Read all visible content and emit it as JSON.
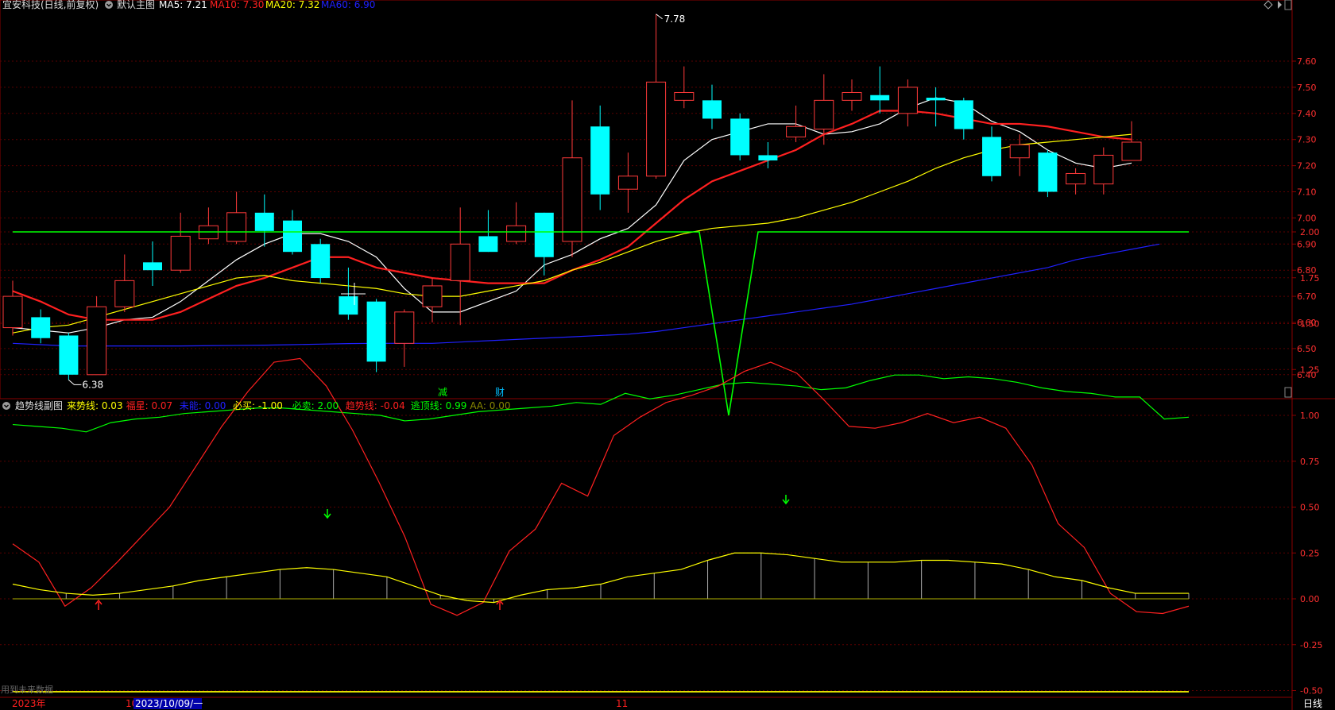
{
  "main_header": {
    "stock_title": "宜安科技(日线,前复权)",
    "chart_name": "默认主图",
    "ma5": {
      "label": "MA5: 7.21",
      "color": "#ffffff"
    },
    "ma10": {
      "label": "MA10: 7.30",
      "color": "#ff2020"
    },
    "ma20": {
      "label": "MA20: 7.32",
      "color": "#ffff00"
    },
    "ma60": {
      "label": "MA60: 6.90",
      "color": "#2020ff"
    }
  },
  "sub_header": {
    "chart_name": "趋势线副图",
    "items": [
      {
        "label": "来势线: 0.03",
        "color": "#ffff00"
      },
      {
        "label": "福星: 0.07",
        "color": "#ff2020"
      },
      {
        "label": "未能: 0.00",
        "color": "#2020ff"
      },
      {
        "label": "必买: -1.00",
        "color": "#ffff00"
      },
      {
        "label": "必卖: 2.00",
        "color": "#00ff00"
      },
      {
        "label": "趋势线: -0.04",
        "color": "#ff2020"
      },
      {
        "label": "逃顶线: 0.99",
        "color": "#00ff00"
      },
      {
        "label": "AA: 0.00",
        "color": "#888800"
      }
    ]
  },
  "price_axis": {
    "ticks": [
      "7.60",
      "7.50",
      "7.40",
      "7.30",
      "7.20",
      "7.10",
      "7.00",
      "6.90",
      "6.80",
      "6.70",
      "6.60",
      "6.50",
      "6.40"
    ]
  },
  "indicator_axis": {
    "ticks": [
      "2.00",
      "1.75",
      "1.50",
      "1.25",
      "1.00",
      "0.75",
      "0.50",
      "0.25",
      "0.00",
      "-0.25",
      "-0.50"
    ]
  },
  "annotations": {
    "high_label": "7.78",
    "low_label": "6.38",
    "event_1": "减",
    "event_2": "财"
  },
  "bottom_bar": {
    "year": "2023年",
    "marker_10": "10",
    "cursor_date": "2023/10/09/一",
    "marker_11": "11",
    "period": "日线",
    "future_note": "用到未来数据"
  },
  "chart_data": [
    {
      "type": "candlestick",
      "title": "宜安科技(日线,前复权)",
      "ylim": [
        6.34,
        7.8
      ],
      "candles": [
        {
          "o": 6.58,
          "h": 6.76,
          "l": 6.55,
          "c": 6.7
        },
        {
          "o": 6.62,
          "h": 6.65,
          "l": 6.52,
          "c": 6.54
        },
        {
          "o": 6.55,
          "h": 6.56,
          "l": 6.38,
          "c": 6.4
        },
        {
          "o": 6.4,
          "h": 6.7,
          "l": 6.4,
          "c": 6.66
        },
        {
          "o": 6.66,
          "h": 6.86,
          "l": 6.64,
          "c": 6.76
        },
        {
          "o": 6.83,
          "h": 6.91,
          "l": 6.74,
          "c": 6.8
        },
        {
          "o": 6.8,
          "h": 7.02,
          "l": 6.79,
          "c": 6.93
        },
        {
          "o": 6.92,
          "h": 7.04,
          "l": 6.9,
          "c": 6.97
        },
        {
          "o": 6.91,
          "h": 7.1,
          "l": 6.9,
          "c": 7.02
        },
        {
          "o": 7.02,
          "h": 7.09,
          "l": 6.89,
          "c": 6.95
        },
        {
          "o": 6.99,
          "h": 7.03,
          "l": 6.86,
          "c": 6.87
        },
        {
          "o": 6.9,
          "h": 6.92,
          "l": 6.75,
          "c": 6.77
        },
        {
          "o": 6.7,
          "h": 6.81,
          "l": 6.61,
          "c": 6.63
        },
        {
          "o": 6.68,
          "h": 6.69,
          "l": 6.41,
          "c": 6.45
        },
        {
          "o": 6.52,
          "h": 6.65,
          "l": 6.43,
          "c": 6.64
        },
        {
          "o": 6.66,
          "h": 6.77,
          "l": 6.6,
          "c": 6.74
        },
        {
          "o": 6.76,
          "h": 7.04,
          "l": 6.59,
          "c": 6.9
        },
        {
          "o": 6.93,
          "h": 7.03,
          "l": 6.87,
          "c": 6.87
        },
        {
          "o": 6.91,
          "h": 7.06,
          "l": 6.9,
          "c": 6.97
        },
        {
          "o": 7.02,
          "h": 7.02,
          "l": 6.78,
          "c": 6.85
        },
        {
          "o": 6.91,
          "h": 7.45,
          "l": 6.85,
          "c": 7.23
        },
        {
          "o": 7.35,
          "h": 7.43,
          "l": 7.03,
          "c": 7.09
        },
        {
          "o": 7.11,
          "h": 7.25,
          "l": 7.02,
          "c": 7.16
        },
        {
          "o": 7.16,
          "h": 7.78,
          "l": 7.15,
          "c": 7.52
        },
        {
          "o": 7.45,
          "h": 7.58,
          "l": 7.42,
          "c": 7.48
        },
        {
          "o": 7.45,
          "h": 7.51,
          "l": 7.34,
          "c": 7.38
        },
        {
          "o": 7.38,
          "h": 7.4,
          "l": 7.22,
          "c": 7.24
        },
        {
          "o": 7.24,
          "h": 7.29,
          "l": 7.19,
          "c": 7.22
        },
        {
          "o": 7.31,
          "h": 7.43,
          "l": 7.29,
          "c": 7.35
        },
        {
          "o": 7.34,
          "h": 7.55,
          "l": 7.28,
          "c": 7.45
        },
        {
          "o": 7.45,
          "h": 7.53,
          "l": 7.41,
          "c": 7.48
        },
        {
          "o": 7.47,
          "h": 7.58,
          "l": 7.4,
          "c": 7.45
        },
        {
          "o": 7.4,
          "h": 7.53,
          "l": 7.35,
          "c": 7.5
        },
        {
          "o": 7.46,
          "h": 7.5,
          "l": 7.35,
          "c": 7.45
        },
        {
          "o": 7.45,
          "h": 7.46,
          "l": 7.3,
          "c": 7.34
        },
        {
          "o": 7.31,
          "h": 7.35,
          "l": 7.14,
          "c": 7.16
        },
        {
          "o": 7.23,
          "h": 7.32,
          "l": 7.16,
          "c": 7.28
        },
        {
          "o": 7.25,
          "h": 7.26,
          "l": 7.08,
          "c": 7.1
        },
        {
          "o": 7.13,
          "h": 7.19,
          "l": 7.09,
          "c": 7.17
        },
        {
          "o": 7.13,
          "h": 7.27,
          "l": 7.09,
          "c": 7.24
        },
        {
          "o": 7.22,
          "h": 7.37,
          "l": 7.22,
          "c": 7.29
        }
      ],
      "series": [
        {
          "name": "MA5",
          "color": "#ffffff",
          "values": [
            6.58,
            6.57,
            6.56,
            6.58,
            6.61,
            6.62,
            6.68,
            6.76,
            6.84,
            6.9,
            6.94,
            6.94,
            6.91,
            6.85,
            6.73,
            6.64,
            6.64,
            6.68,
            6.72,
            6.82,
            6.86,
            6.92,
            6.96,
            7.05,
            7.22,
            7.3,
            7.33,
            7.36,
            7.36,
            7.32,
            7.33,
            7.36,
            7.42,
            7.46,
            7.44,
            7.37,
            7.33,
            7.26,
            7.21,
            7.19,
            7.21
          ]
        },
        {
          "name": "MA10",
          "color": "#ff2020",
          "values": [
            6.72,
            6.68,
            6.63,
            6.61,
            6.61,
            6.61,
            6.64,
            6.69,
            6.74,
            6.77,
            6.81,
            6.85,
            6.85,
            6.81,
            6.79,
            6.77,
            6.76,
            6.75,
            6.75,
            6.75,
            6.8,
            6.84,
            6.89,
            6.98,
            7.07,
            7.14,
            7.18,
            7.22,
            7.26,
            7.32,
            7.36,
            7.41,
            7.41,
            7.4,
            7.38,
            7.36,
            7.36,
            7.35,
            7.33,
            7.31,
            7.3
          ]
        },
        {
          "name": "MA20",
          "color": "#ffff00",
          "values": [
            6.56,
            6.58,
            6.59,
            6.62,
            6.65,
            6.68,
            6.71,
            6.74,
            6.77,
            6.78,
            6.76,
            6.75,
            6.74,
            6.73,
            6.71,
            6.7,
            6.7,
            6.72,
            6.74,
            6.76,
            6.8,
            6.83,
            6.87,
            6.91,
            6.94,
            6.96,
            6.97,
            6.98,
            7.0,
            7.03,
            7.06,
            7.1,
            7.14,
            7.19,
            7.23,
            7.26,
            7.28,
            7.29,
            7.3,
            7.31,
            7.32
          ]
        },
        {
          "name": "MA60",
          "color": "#2020ff",
          "values": [
            6.52,
            6.515,
            6.51,
            6.51,
            6.51,
            6.51,
            6.51,
            6.511,
            6.512,
            6.513,
            6.515,
            6.517,
            6.519,
            6.52,
            6.52,
            6.52,
            6.525,
            6.53,
            6.535,
            6.54,
            6.545,
            6.55,
            6.555,
            6.565,
            6.58,
            6.595,
            6.61,
            6.625,
            6.64,
            6.655,
            6.67,
            6.69,
            6.71,
            6.73,
            6.75,
            6.77,
            6.79,
            6.81,
            6.84,
            6.86,
            6.88,
            6.9
          ]
        }
      ]
    },
    {
      "type": "line",
      "title": "趋势线副图",
      "ylim": [
        -0.6,
        2.1
      ],
      "series": [
        {
          "name": "趋势线",
          "color": "#ff2020",
          "values": [
            0.3,
            0.2,
            -0.04,
            0.06,
            0.2,
            0.35,
            0.5,
            0.72,
            0.94,
            1.13,
            1.29,
            1.31,
            1.16,
            0.92,
            0.64,
            0.34,
            -0.03,
            -0.09,
            -0.02,
            0.26,
            0.38,
            0.63,
            0.56,
            0.89,
            0.99,
            1.07,
            1.11,
            1.16,
            1.24,
            1.29,
            1.23,
            1.09,
            0.94,
            0.93,
            0.96,
            1.01,
            0.96,
            0.99,
            0.93,
            0.73,
            0.41,
            0.28,
            0.03,
            -0.07,
            -0.08,
            -0.04
          ]
        },
        {
          "name": "逃顶线",
          "color": "#00ff00",
          "values": [
            0.95,
            0.94,
            0.93,
            0.91,
            0.96,
            0.98,
            0.99,
            1.01,
            1.02,
            1.03,
            1.04,
            1.04,
            1.03,
            1.02,
            1.01,
            1.0,
            0.97,
            0.98,
            1.0,
            1.02,
            1.03,
            1.04,
            1.05,
            1.07,
            1.06,
            1.12,
            1.09,
            1.11,
            1.14,
            1.17,
            1.18,
            1.17,
            1.16,
            1.14,
            1.15,
            1.19,
            1.22,
            1.22,
            1.2,
            1.21,
            1.2,
            1.18,
            1.15,
            1.13,
            1.12,
            1.1,
            1.1,
            0.98,
            0.99
          ]
        },
        {
          "name": "来势线",
          "color": "#ffff00",
          "values": [
            0.08,
            0.05,
            0.03,
            0.02,
            0.03,
            0.05,
            0.07,
            0.1,
            0.12,
            0.14,
            0.16,
            0.17,
            0.16,
            0.14,
            0.12,
            0.07,
            0.02,
            -0.01,
            -0.02,
            0.02,
            0.05,
            0.06,
            0.08,
            0.12,
            0.14,
            0.16,
            0.21,
            0.25,
            0.25,
            0.24,
            0.22,
            0.2,
            0.2,
            0.2,
            0.21,
            0.21,
            0.2,
            0.19,
            0.16,
            0.12,
            0.1,
            0.06,
            0.03,
            0.03,
            0.03
          ]
        },
        {
          "name": "必卖",
          "color": "#00ff00",
          "values": [
            2.0,
            2.0,
            1.0,
            2.0,
            2.0
          ]
        },
        {
          "name": "必买",
          "color": "#ffff00",
          "values": [
            -1.0
          ]
        }
      ],
      "buy_arrows": 2,
      "sell_arrows": 2
    }
  ]
}
